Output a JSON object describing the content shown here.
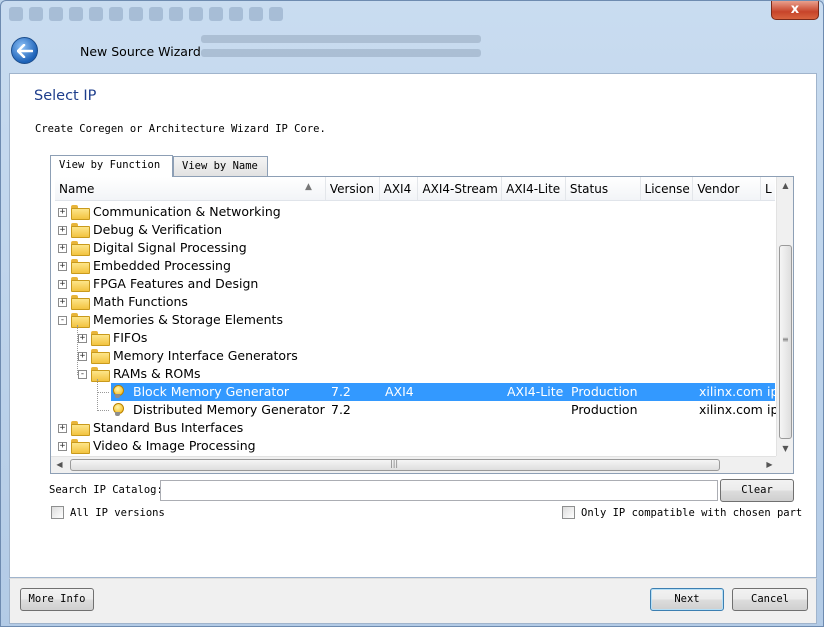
{
  "wizard": {
    "title": "New Source Wizard",
    "close_label": "x"
  },
  "page": {
    "heading": "Select IP",
    "description": "Create Coregen or Architecture Wizard IP Core."
  },
  "tabs": [
    {
      "label": "View by Function",
      "active": true
    },
    {
      "label": "View by Name",
      "active": false
    }
  ],
  "table": {
    "columns": [
      "Name",
      "Version",
      "AXI4",
      "AXI4-Stream",
      "AXI4-Lite",
      "Status",
      "License",
      "Vendor",
      "L"
    ],
    "rows": [
      {
        "label": "Communication & Networking",
        "level": 0,
        "kind": "folder",
        "expander": "+"
      },
      {
        "label": "Debug & Verification",
        "level": 0,
        "kind": "folder",
        "expander": "+"
      },
      {
        "label": "Digital Signal Processing",
        "level": 0,
        "kind": "folder",
        "expander": "+"
      },
      {
        "label": "Embedded Processing",
        "level": 0,
        "kind": "folder",
        "expander": "+"
      },
      {
        "label": "FPGA Features and Design",
        "level": 0,
        "kind": "folder",
        "expander": "+"
      },
      {
        "label": "Math Functions",
        "level": 0,
        "kind": "folder",
        "expander": "+"
      },
      {
        "label": "Memories & Storage Elements",
        "level": 0,
        "kind": "folder",
        "expander": "-"
      },
      {
        "label": "FIFOs",
        "level": 1,
        "kind": "folder",
        "expander": "+"
      },
      {
        "label": "Memory Interface Generators",
        "level": 1,
        "kind": "folder",
        "expander": "+"
      },
      {
        "label": "RAMs & ROMs",
        "level": 1,
        "kind": "folder",
        "expander": "-"
      },
      {
        "label": "Block Memory Generator",
        "level": 2,
        "kind": "ip",
        "selected": true,
        "version": "7.2",
        "axi4": "AXI4",
        "axi4_stream": "",
        "axi4_lite": "AXI4-Lite",
        "status": "Production",
        "license": "",
        "vendor": "xilinx.com",
        "l": "ip"
      },
      {
        "label": "Distributed Memory Generator",
        "level": 2,
        "kind": "ip",
        "selected": false,
        "version": "7.2",
        "axi4": "",
        "axi4_stream": "",
        "axi4_lite": "",
        "status": "Production",
        "license": "",
        "vendor": "xilinx.com",
        "l": "ip"
      },
      {
        "label": "Standard Bus Interfaces",
        "level": 0,
        "kind": "folder",
        "expander": "+"
      },
      {
        "label": "Video & Image Processing",
        "level": 0,
        "kind": "folder",
        "expander": "+"
      }
    ]
  },
  "search": {
    "label": "Search IP Catalog:",
    "value": "",
    "clear_label": "Clear"
  },
  "options": {
    "all_versions_label": "All IP versions",
    "all_versions_checked": false,
    "compatible_label": "Only IP compatible with chosen part",
    "compatible_checked": false
  },
  "footer": {
    "more_info_label": "More Info",
    "next_label": "Next",
    "cancel_label": "Cancel"
  }
}
